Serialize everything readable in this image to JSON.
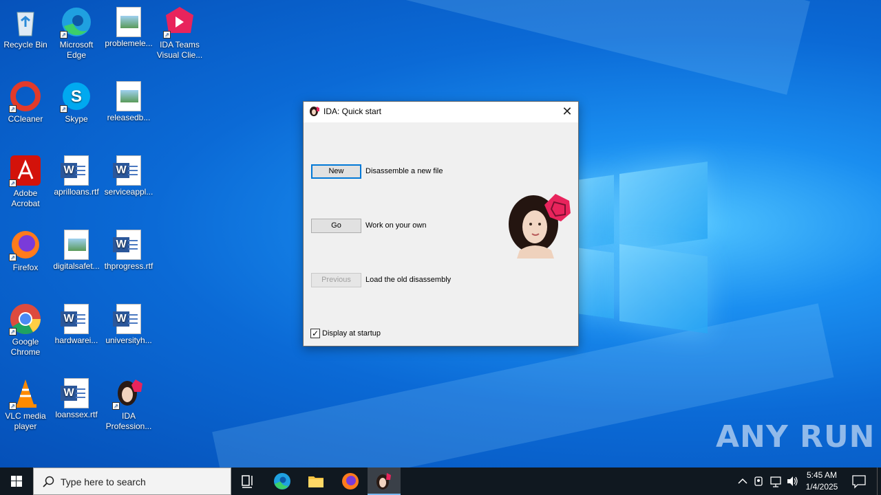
{
  "desktop": {
    "icons": [
      {
        "label": "Recycle Bin"
      },
      {
        "label": "Microsoft Edge"
      },
      {
        "label": "problemele..."
      },
      {
        "label": "IDA Teams Visual Clie..."
      },
      {
        "label": "CCleaner"
      },
      {
        "label": "Skype"
      },
      {
        "label": "releasedb..."
      },
      {
        "label": "Adobe Acrobat"
      },
      {
        "label": "aprilloans.rtf"
      },
      {
        "label": "serviceappl..."
      },
      {
        "label": "Firefox"
      },
      {
        "label": "digitalsafet..."
      },
      {
        "label": "thprogress.rtf"
      },
      {
        "label": "Google Chrome"
      },
      {
        "label": "hardwarei..."
      },
      {
        "label": "universityh..."
      },
      {
        "label": "VLC media player"
      },
      {
        "label": "loanssex.rtf"
      },
      {
        "label": "IDA Profession..."
      }
    ]
  },
  "dialog": {
    "title": "IDA: Quick start",
    "close_glyph": "✕",
    "new_button": "New",
    "new_desc": "Disassemble a new file",
    "go_button": "Go",
    "go_desc": "Work on your own",
    "previous_button": "Previous",
    "previous_desc": "Load the old disassembly",
    "display_at_startup_label": "Display at startup",
    "display_at_startup_checked": true,
    "check_glyph": "✓"
  },
  "watermark": "ANY RUN",
  "taskbar": {
    "search_placeholder": "Type here to search",
    "time": "5:45 AM",
    "date": "1/4/2025",
    "pinned": [
      "task-view",
      "edge",
      "file-explorer",
      "firefox",
      "ida"
    ]
  },
  "colors": {
    "taskbar_bg": "#101820",
    "dialog_bg": "#f0f0f0",
    "focus_blue": "#0078d7",
    "ida_pink": "#e8245c"
  }
}
